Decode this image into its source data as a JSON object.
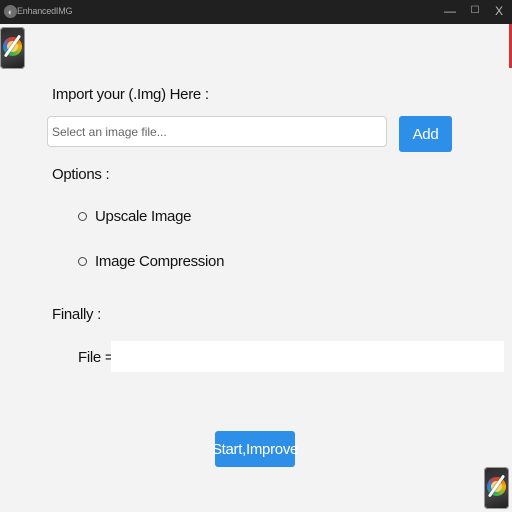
{
  "window": {
    "title": "EnhancedIMG",
    "minimize_glyph": "—",
    "maximize_glyph": "☐",
    "close_glyph": "X"
  },
  "import": {
    "label": "Import your (.Img) Here :",
    "placeholder": "Select an image file...",
    "value": "",
    "add_label": "Add"
  },
  "options": {
    "label": "Options :",
    "items": [
      {
        "label": "Upscale Image",
        "selected": false
      },
      {
        "label": "Image Compression",
        "selected": false
      }
    ]
  },
  "finally": {
    "label": "Finally :",
    "file_label": "File =",
    "file_value": ""
  },
  "actions": {
    "start_label": "Start,Improve"
  },
  "icons": {
    "app": "app-icon",
    "logo": "magic-wand-logo-icon"
  },
  "colors": {
    "accent": "#2d8fe8",
    "titlebar": "#202020",
    "background": "#f3f3f3",
    "close_edge": "#d13438"
  }
}
